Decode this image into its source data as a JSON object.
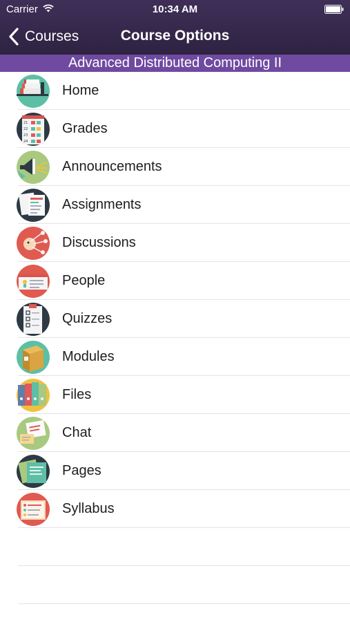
{
  "status_bar": {
    "carrier": "Carrier",
    "time": "10:34 AM"
  },
  "nav": {
    "back_label": "Courses",
    "title": "Course Options"
  },
  "course_name": "Advanced Distributed Computing II",
  "colors": {
    "header": "#3a2c52",
    "banner": "#6f4aa0"
  },
  "menu": [
    {
      "label": "Home",
      "icon": "home-icon"
    },
    {
      "label": "Grades",
      "icon": "grades-icon"
    },
    {
      "label": "Announcements",
      "icon": "announcements-icon"
    },
    {
      "label": "Assignments",
      "icon": "assignments-icon"
    },
    {
      "label": "Discussions",
      "icon": "discussions-icon"
    },
    {
      "label": "People",
      "icon": "people-icon"
    },
    {
      "label": "Quizzes",
      "icon": "quizzes-icon"
    },
    {
      "label": "Modules",
      "icon": "modules-icon"
    },
    {
      "label": "Files",
      "icon": "files-icon"
    },
    {
      "label": "Chat",
      "icon": "chat-icon"
    },
    {
      "label": "Pages",
      "icon": "pages-icon"
    },
    {
      "label": "Syllabus",
      "icon": "syllabus-icon"
    }
  ],
  "grade_rows": [
    "21",
    "22",
    "23",
    "24"
  ]
}
